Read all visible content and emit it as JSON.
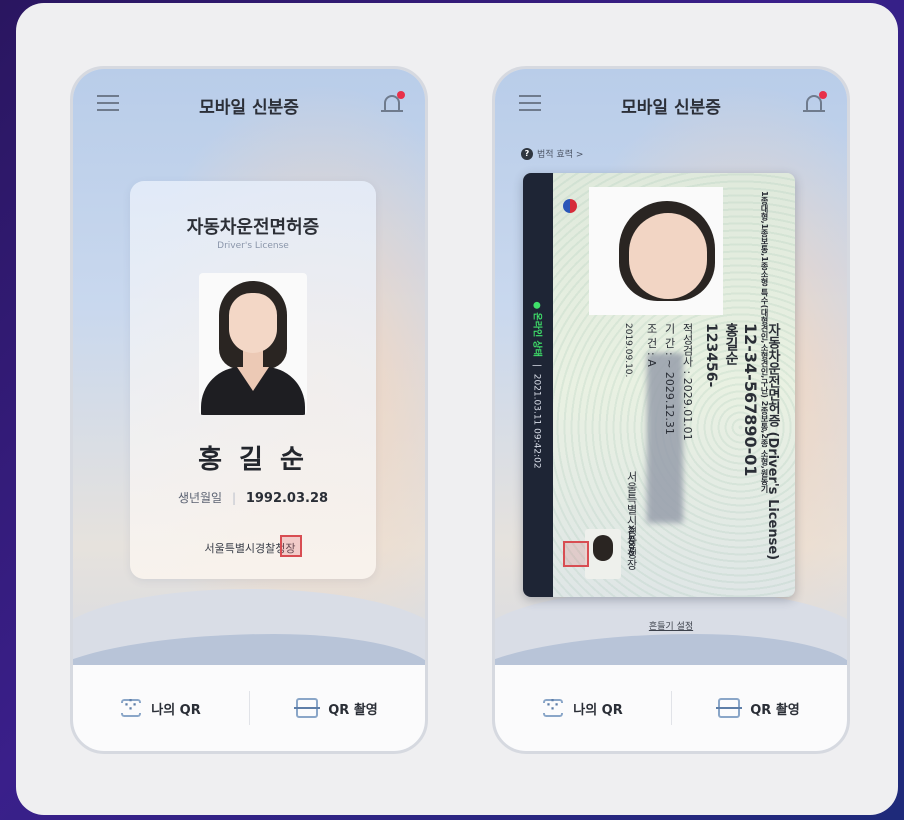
{
  "app_title": "모바일 신분증",
  "left_card": {
    "title": "자동차운전면허증",
    "subtitle": "Driver's License",
    "name": "홍 길 순",
    "dob_label": "생년월일",
    "dob_value": "1992.03.28",
    "issuer": "서울특별시경찰청장"
  },
  "right_card": {
    "legal_label": "법적 효력 >",
    "strip_online": "● 온라인 상태",
    "strip_time": "2021.03.11 09:42:02",
    "classes": "1종대형,1종보통,1종소형\n특수(대형견인,소형견인,구난)\n2종보통,2종 소형,원동기",
    "header": "자동차운전면허증 (Driver's License)",
    "license_number": "12-34-567890-01",
    "name": "홍길순",
    "rrn": "123456-",
    "field1": "적성검사 : 2029.01.01",
    "field2": "기    간 : ~ 2029.12.31",
    "field3": "조    건 : A",
    "issue_date": "2019.09.10.",
    "issuer": "서울특별시경찰청장",
    "code": "XLED7D",
    "shake_setting": "흔들기 설정"
  },
  "bottom": {
    "my_qr": "나의 QR",
    "scan_qr": "QR 촬영"
  },
  "colors": {
    "online": "#3fe06a",
    "notification_dot": "#e8304a",
    "seal": "#d84d52"
  }
}
